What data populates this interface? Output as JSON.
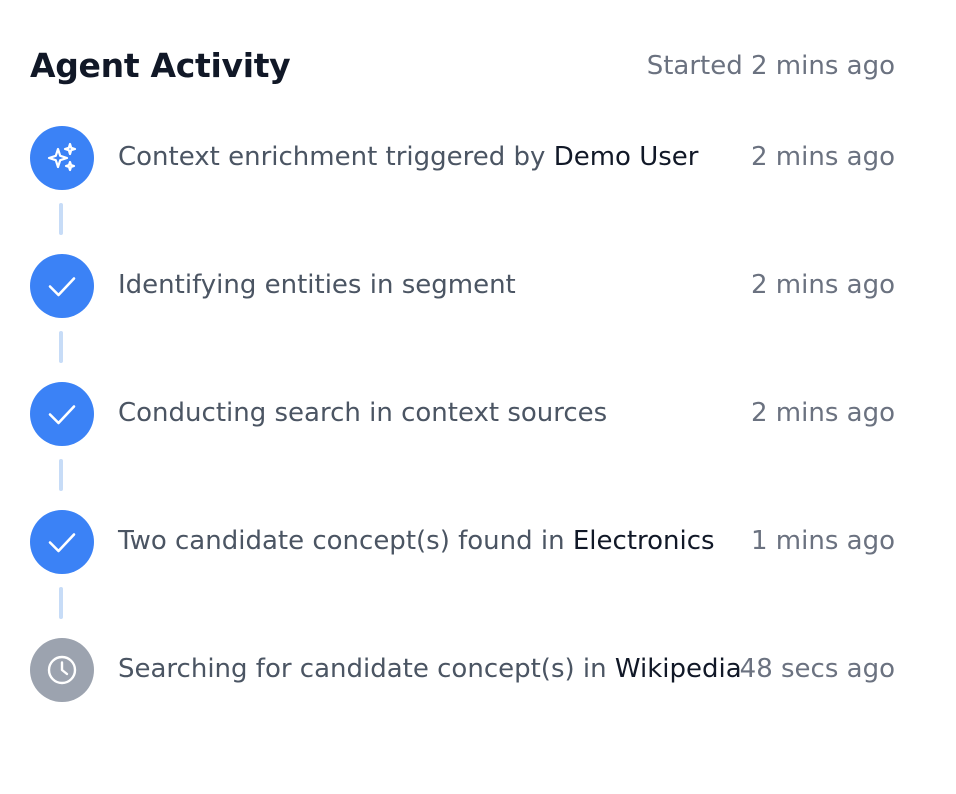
{
  "header": {
    "title": "Agent Activity",
    "started": "Started 2 mins ago"
  },
  "colors": {
    "accent": "#3b82f6",
    "pending": "#9ca3af",
    "connector": "#c7dcf7"
  },
  "activities": [
    {
      "icon": "sparkles-icon",
      "status": "triggered",
      "text": "Context enrichment triggered by ",
      "highlight": "Demo User",
      "time": "2 mins ago"
    },
    {
      "icon": "check-icon",
      "status": "done",
      "text": "Identifying entities in segment",
      "highlight": "",
      "time": "2 mins ago"
    },
    {
      "icon": "check-icon",
      "status": "done",
      "text": "Conducting search in context sources",
      "highlight": "",
      "time": "2 mins ago"
    },
    {
      "icon": "check-icon",
      "status": "done",
      "text": "Two candidate concept(s) found in ",
      "highlight": "Electronics",
      "time": "1 mins ago"
    },
    {
      "icon": "clock-icon",
      "status": "pending",
      "text": "Searching for candidate concept(s) in ",
      "highlight": "Wikipedia",
      "time": "48 secs ago"
    }
  ]
}
